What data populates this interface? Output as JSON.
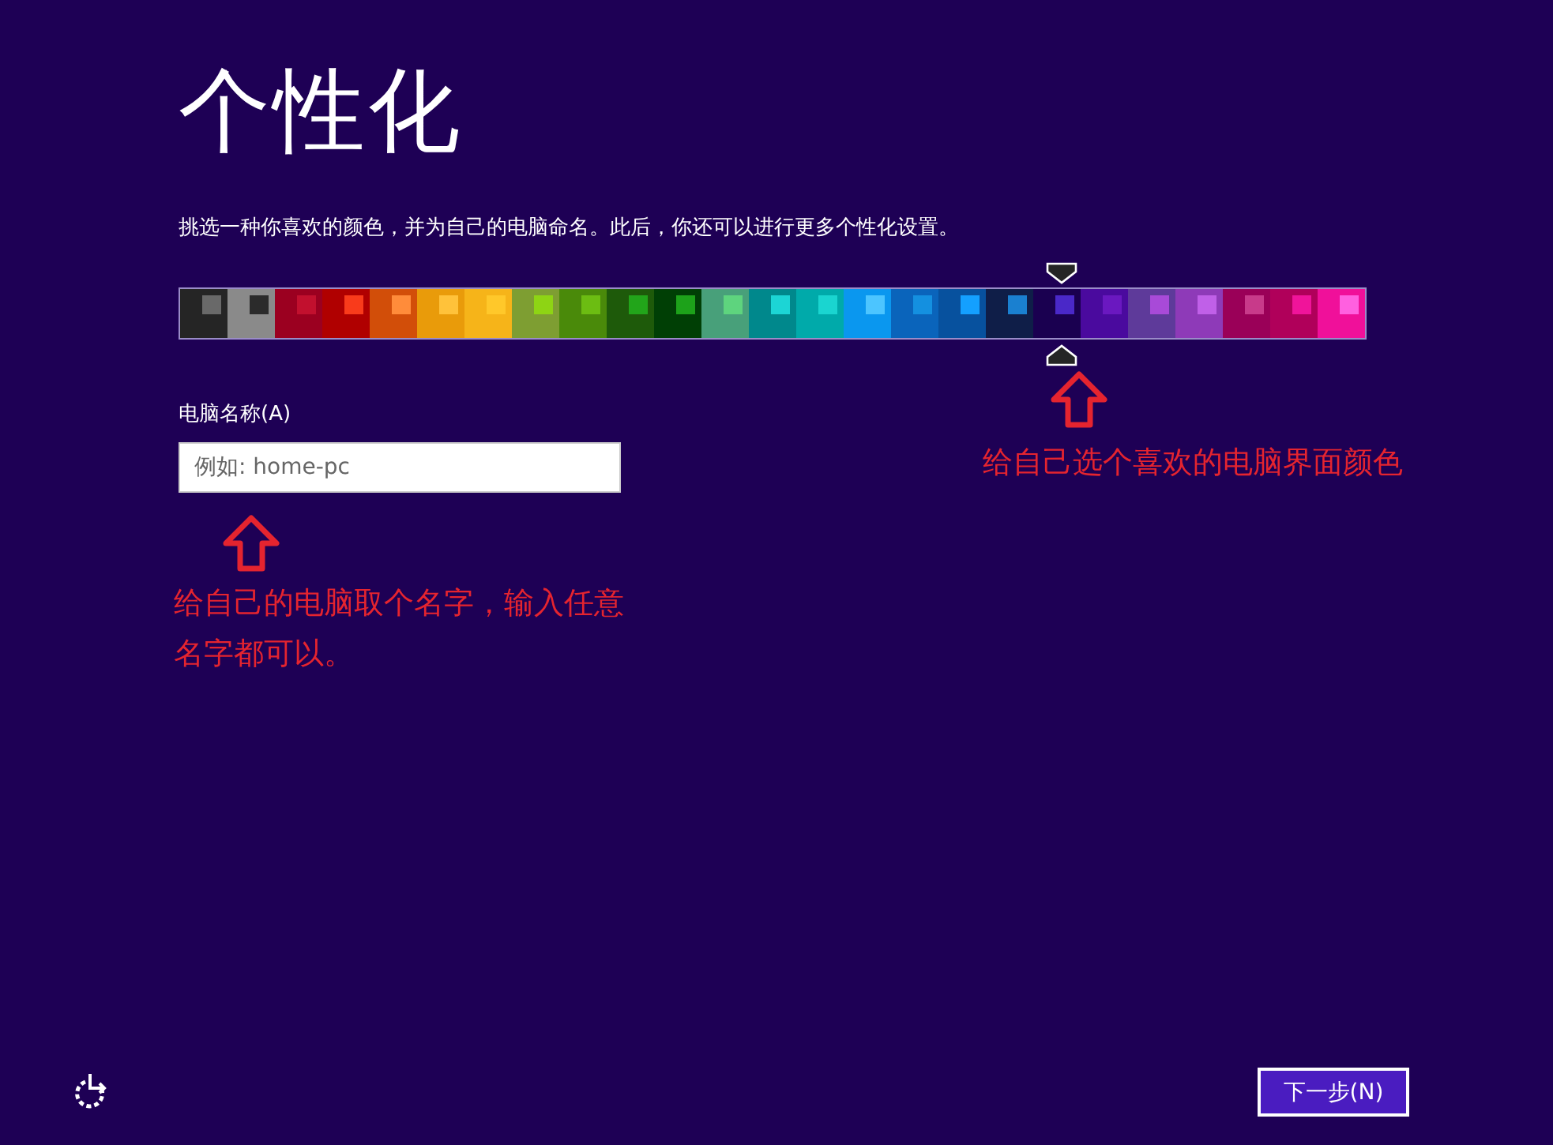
{
  "title": "个性化",
  "description": "挑选一种你喜欢的颜色，并为自己的电脑命名。此后，你还可以进行更多个性化设置。",
  "swatches": [
    {
      "color": "#252525",
      "accent": {
        "color": "#696969"
      },
      "selected": false
    },
    {
      "color": "#8a8a8a",
      "accent": {
        "color": "#2b2b2b"
      },
      "selected": false
    },
    {
      "color": "#9b0020",
      "accent": {
        "color": "#c2102e"
      },
      "selected": false
    },
    {
      "color": "#b00000",
      "accent": {
        "color": "#f93b1b"
      },
      "selected": false
    },
    {
      "color": "#d24e09",
      "accent": {
        "color": "#ff8c3a"
      },
      "selected": false
    },
    {
      "color": "#e99b0a",
      "accent": {
        "color": "#ffc23a"
      },
      "selected": false
    },
    {
      "color": "#f6b419",
      "accent": {
        "color": "#ffc82a"
      },
      "selected": false
    },
    {
      "color": "#7e9e32",
      "accent": {
        "color": "#8ed414"
      },
      "selected": false
    },
    {
      "color": "#4a8a0a",
      "accent": {
        "color": "#6cbd12"
      },
      "selected": false
    },
    {
      "color": "#1e5a0a",
      "accent": {
        "color": "#22a51a"
      },
      "selected": false
    },
    {
      "color": "#003f05",
      "accent": {
        "color": "#1da21a"
      },
      "selected": false
    },
    {
      "color": "#48a07a",
      "accent": {
        "color": "#5ed47e"
      },
      "selected": false
    },
    {
      "color": "#00888c",
      "accent": {
        "color": "#1cd5d5"
      },
      "selected": false
    },
    {
      "color": "#00aaaa",
      "accent": {
        "color": "#1ad5d0"
      },
      "selected": false
    },
    {
      "color": "#0a97ef",
      "accent": {
        "color": "#4cc5ff"
      },
      "selected": false
    },
    {
      "color": "#0a64bb",
      "accent": {
        "color": "#1490e0"
      },
      "selected": false
    },
    {
      "color": "#07519e",
      "accent": {
        "color": "#14a0ff"
      },
      "selected": false
    },
    {
      "color": "#0f1e48",
      "accent": {
        "color": "#1a80d0"
      },
      "selected": false
    },
    {
      "color": "#1a0050",
      "accent": {
        "color": "#4a28c8"
      },
      "selected": true
    },
    {
      "color": "#4a0a9e",
      "accent": {
        "color": "#6a18c0"
      },
      "selected": false
    },
    {
      "color": "#5e3a9a",
      "accent": {
        "color": "#a84ad8"
      },
      "selected": false
    },
    {
      "color": "#8e3ab8",
      "accent": {
        "color": "#c060e8"
      },
      "selected": false
    },
    {
      "color": "#9a0058",
      "accent": {
        "color": "#c83a8a"
      },
      "selected": false
    },
    {
      "color": "#b0005a",
      "accent": {
        "color": "#f0149a"
      },
      "selected": false
    },
    {
      "color": "#f0109a",
      "accent": {
        "color": "#ff60e0"
      },
      "selected": false
    }
  ],
  "name_field": {
    "label": "电脑名称(A)",
    "placeholder": "例如: home-pc"
  },
  "annotations": [
    {
      "text": "给自己选个喜欢的电脑界面颜色"
    },
    {
      "text": "给自己的电脑取个名字，输入任意名字都可以。"
    }
  ],
  "next_button": "下一步(N)"
}
